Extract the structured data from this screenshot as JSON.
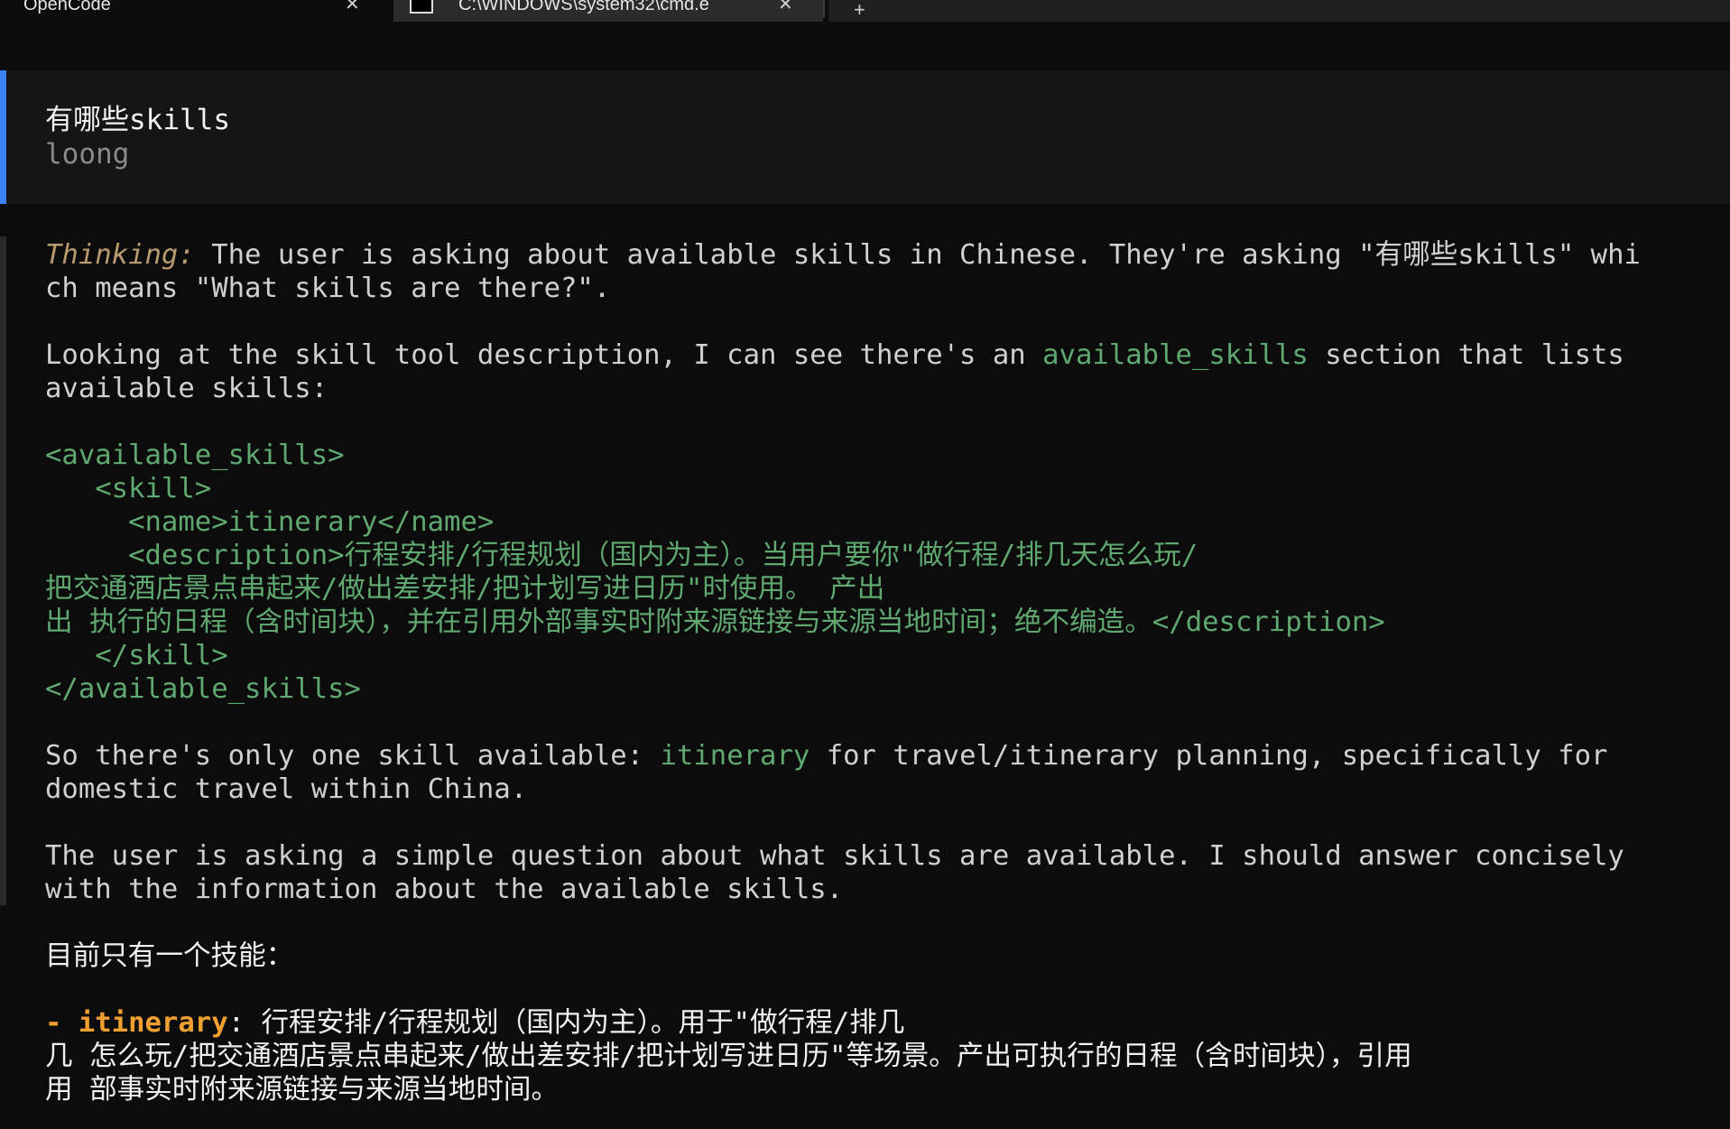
{
  "tabs": [
    {
      "title": "OpenCode",
      "close": "✕"
    },
    {
      "title": "C:\\WINDOWS\\system32\\cmd.e",
      "close": "✕"
    }
  ],
  "new_tab": "+",
  "user_message": {
    "text": "有哪些skills",
    "author": "loong"
  },
  "thinking": {
    "label": "Thinking:",
    "line1": " The user is asking about available skills in Chinese. They're asking \"有哪些skills\" whi",
    "line2": "ch means \"What skills are there?\".",
    "para2_a": "Looking at the skill tool description, I can see there's an ",
    "para2_hl": "available_skills",
    "para2_b": " section that lists",
    "para2_line2": "available skills:",
    "xml": [
      "<available_skills>",
      "   <skill>",
      "     <name>itinerary</name>",
      "     <description>行程安排/行程规划（国内为主）。当用户要你\"做行程/排几天怎么玩/",
      "把交通酒店景点串起来/做出差安排/把计划写进日历\"时使用。 产出",
      "出 执行的日程（含时间块），并在引用外部事实时附来源链接与来源当地时间；绝不编造。</description>",
      "   </skill>",
      "</available_skills>"
    ],
    "para4_a": "So there's only one skill available: ",
    "para4_hl": "itinerary",
    "para4_b": " for travel/itinerary planning, specifically for",
    "para4_line2": "domestic travel within China.",
    "para5_line1": "The user is asking a simple question about what skills are available. I should answer concisely",
    "para5_line2": "with the information about the available skills."
  },
  "answer": {
    "intro": "目前只有一个技能：",
    "bullet_dash": "- itinerary",
    "bullet_line1": ": 行程安排/行程规划（国内为主）。用于\"做行程/排几",
    "bullet_line2": "几 怎么玩/把交通酒店景点串起来/做出差安排/把计划写进日历\"等场景。产出可执行的日程（含时间块），引用",
    "bullet_line3": "用 部事实时附来源链接与来源当地时间。"
  }
}
